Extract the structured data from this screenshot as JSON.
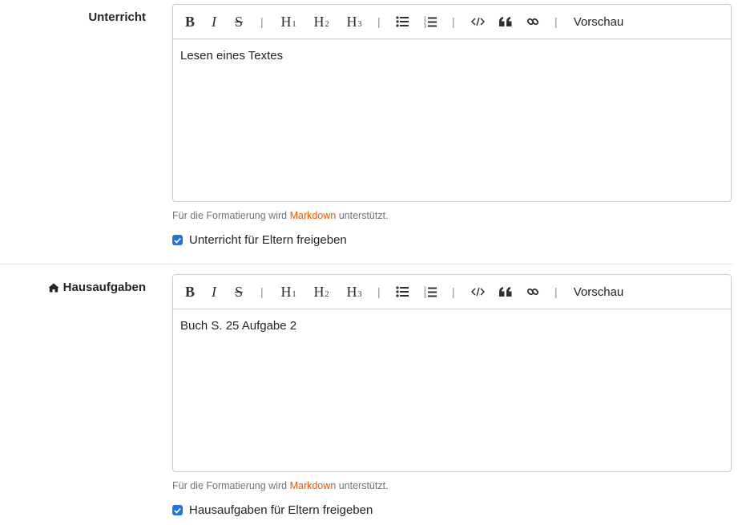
{
  "toolbar": {
    "bold": "B",
    "italic": "I",
    "strike": "S",
    "h1": "H",
    "h1_sub": "1",
    "h2": "H",
    "h2_sub": "2",
    "h3": "H",
    "h3_sub": "3",
    "separator": "|",
    "preview": "Vorschau"
  },
  "sections": [
    {
      "label": "Unterricht",
      "content": "Lesen eines Textes",
      "help_prefix": "Für die Formatierung wird ",
      "help_link": "Markdown",
      "help_suffix": " unterstützt.",
      "checkbox_label": "Unterricht für Eltern freigeben",
      "checked": true
    },
    {
      "label": "Hausaufgaben",
      "icon": "home-icon",
      "content": "Buch S. 25 Aufgabe 2",
      "help_prefix": "Für die Formatierung wird ",
      "help_link": "Markdown",
      "help_suffix": " unterstützt.",
      "checkbox_label": "Hausaufgaben für Eltern freigeben",
      "checked": true
    }
  ],
  "colors": {
    "link": "#e8590c",
    "checkbox": "#1f73e8",
    "border": "#c8ccd0"
  }
}
